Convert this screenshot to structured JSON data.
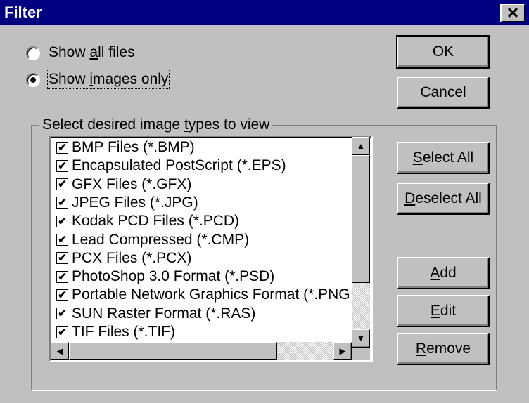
{
  "window": {
    "title": "Filter",
    "close_glyph": "✕"
  },
  "radios": [
    {
      "pre": "Show ",
      "mn": "a",
      "post": "ll files",
      "checked": false
    },
    {
      "pre": "Show ",
      "mn": "i",
      "post": "mages only",
      "checked": true
    }
  ],
  "buttons": {
    "ok": "OK",
    "cancel": "Cancel",
    "select_all": {
      "mn": "S",
      "rest": "elect All"
    },
    "deselect_all": {
      "mn": "D",
      "rest": "eselect All"
    },
    "add": {
      "mn": "A",
      "rest": "dd"
    },
    "edit": {
      "mn": "E",
      "rest": "dit"
    },
    "remove": {
      "mn": "R",
      "rest": "emove"
    }
  },
  "group": {
    "pre": "Select desired image ",
    "mn": "t",
    "post": "ypes to view"
  },
  "list_items": [
    {
      "label": "BMP Files (*.BMP)",
      "checked": true
    },
    {
      "label": "Encapsulated PostScript (*.EPS)",
      "checked": true
    },
    {
      "label": "GFX Files (*.GFX)",
      "checked": true
    },
    {
      "label": "JPEG Files (*.JPG)",
      "checked": true
    },
    {
      "label": "Kodak PCD Files (*.PCD)",
      "checked": true
    },
    {
      "label": "Lead Compressed (*.CMP)",
      "checked": true
    },
    {
      "label": "PCX Files (*.PCX)",
      "checked": true
    },
    {
      "label": "PhotoShop 3.0 Format (*.PSD)",
      "checked": true
    },
    {
      "label": "Portable Network Graphics Format (*.PNG",
      "checked": true
    },
    {
      "label": "SUN Raster Format (*.RAS)",
      "checked": true
    },
    {
      "label": "TIF Files (*.TIF)",
      "checked": true
    }
  ],
  "scroll_glyphs": {
    "up": "▲",
    "down": "▼",
    "left": "◀",
    "right": "▶"
  },
  "check_glyph": "✔"
}
